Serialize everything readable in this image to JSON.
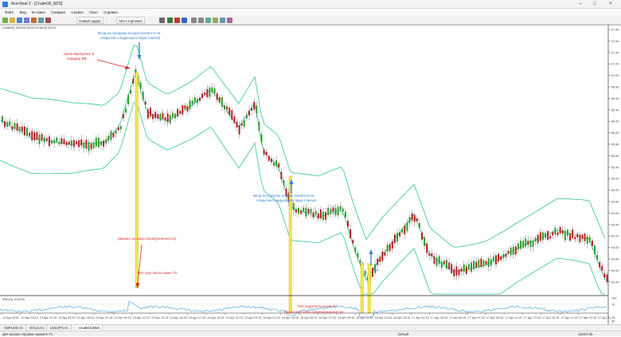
{
  "window": {
    "title": "Ace-Real 2 - [CrudeOil_M15]"
  },
  "menu": [
    "Файл",
    "Вид",
    "Вставка",
    "Графики",
    "Сервис",
    "Окно",
    "Справка"
  ],
  "toolbar": {
    "new_order": "Новый ордер",
    "autotrade": "Авто-торговля"
  },
  "chart_header": "CrudeOil_M15  69.00 69.04 68.98 69.03",
  "rsi_header": "RSI(14) 70.6276",
  "price_axis": [
    "67.80",
    "67.60",
    "67.40",
    "67.20",
    "67.00",
    "66.80",
    "66.60",
    "66.40",
    "66.20",
    "66.00",
    "65.80",
    "65.60",
    "65.40",
    "65.20",
    "65.00",
    "64.80",
    "64.60",
    "64.40",
    "64.20",
    "64.00",
    "63.80",
    "63.60",
    "63.40"
  ],
  "rsi_axis": [
    "100",
    "70",
    "30",
    "0"
  ],
  "time_axis": [
    "12 Apr 2018",
    "12 Apr 23:15",
    "13 Apr 01:15",
    "13 Apr 03:15",
    "13 Apr 05:15",
    "13 Apr 07:15",
    "13 Apr 09:15",
    "13 Apr 11:15",
    "13 Apr 13:15",
    "13 Apr 15:15",
    "13 Apr 17:15",
    "13 Apr 19:15",
    "13 Apr 21:15",
    "13 Apr 23:15",
    "16 Apr 01:15",
    "16 Apr 03:15",
    "16 Apr 05:15",
    "16 Apr 07:15",
    "16 Apr 09:15",
    "16 Apr 11:15",
    "16 Apr 13:15",
    "16 Apr 15:15",
    "17 Apr 01:15",
    "17 Apr 03:15",
    "17 Apr 05:15",
    "17 Apr 07:15",
    "17 Apr 09:15",
    "17 Apr 11:15",
    "17 Apr 13:15",
    "17 Apr 15:15",
    "17 Apr 17:15",
    "17 Apr 19:15",
    "17 Apr 21:15"
  ],
  "annotations": {
    "sell_entry": [
      "Вход на продажу осуществляется на",
      "открытии следующего бара (свечи)"
    ],
    "price_returned": [
      "Цена вернулась в",
      "коридор BB"
    ],
    "rsi_fell": [
      "RSI опустился ниже 70",
      "(вышел из зоны перекупленности)"
    ],
    "buy_entry": [
      "Вход на покупку осуществляется на",
      "открытии следующего бара (свечи)"
    ],
    "rsi_rose": [
      "RSI поднялся выше 70",
      "(вышел из зоны перепроданности)"
    ],
    "buy_label": "buy"
  },
  "tabs": [
    "GBPUSD,H1",
    "GOLD,H1",
    "USDJPY,H1",
    "CrudeOil,M15"
  ],
  "status": {
    "help": "Для вызова справки нажмите F1",
    "profile": "Default",
    "traffic": "1520/2 kb"
  },
  "colors": {
    "bull": "#2e9d2e",
    "bear": "#b32222",
    "band": "#31c59a",
    "rsi": "#3399dd",
    "highlight": "#f0e84a",
    "annot_blue": "#2f7fd6",
    "annot_red": "#d12b2b"
  }
}
